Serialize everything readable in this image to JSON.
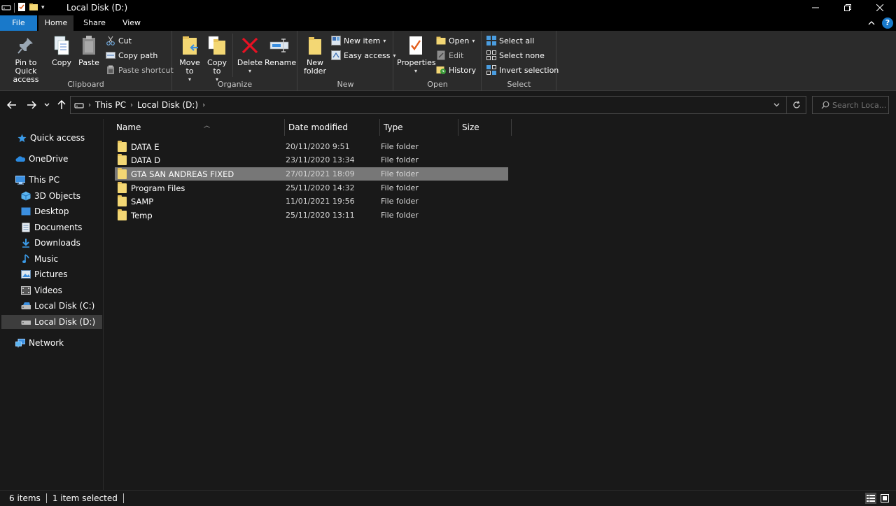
{
  "window": {
    "title": "Local Disk (D:)"
  },
  "tabs": {
    "file": "File",
    "home": "Home",
    "share": "Share",
    "view": "View"
  },
  "ribbon": {
    "clipboard": {
      "label": "Clipboard",
      "pin": "Pin to Quick access",
      "copy": "Copy",
      "paste": "Paste",
      "cut": "Cut",
      "copy_path": "Copy path",
      "paste_shortcut": "Paste shortcut"
    },
    "organize": {
      "label": "Organize",
      "move_to": "Move to",
      "copy_to": "Copy to",
      "delete": "Delete",
      "rename": "Rename"
    },
    "new": {
      "label": "New",
      "new_folder": "New folder",
      "new_item": "New item",
      "easy_access": "Easy access"
    },
    "open": {
      "label": "Open",
      "properties": "Properties",
      "open": "Open",
      "edit": "Edit",
      "history": "History"
    },
    "select": {
      "label": "Select",
      "select_all": "Select all",
      "select_none": "Select none",
      "invert_selection": "Invert selection"
    }
  },
  "address": {
    "crumbs": [
      "This PC",
      "Local Disk (D:)"
    ],
    "search_placeholder": "Search Loca..."
  },
  "sidebar": {
    "items": [
      {
        "label": "Quick access",
        "icon": "star-icon"
      },
      {
        "label": "OneDrive",
        "icon": "cloud-icon"
      },
      {
        "label": "This PC",
        "icon": "computer-icon"
      },
      {
        "label": "3D Objects",
        "icon": "cube-icon"
      },
      {
        "label": "Desktop",
        "icon": "desktop-icon"
      },
      {
        "label": "Documents",
        "icon": "documents-icon"
      },
      {
        "label": "Downloads",
        "icon": "download-icon"
      },
      {
        "label": "Music",
        "icon": "music-icon"
      },
      {
        "label": "Pictures",
        "icon": "pictures-icon"
      },
      {
        "label": "Videos",
        "icon": "videos-icon"
      },
      {
        "label": "Local Disk (C:)",
        "icon": "drive-icon"
      },
      {
        "label": "Local Disk (D:)",
        "icon": "drive-icon"
      },
      {
        "label": "Network",
        "icon": "network-icon"
      }
    ],
    "selected": "Local Disk (D:)"
  },
  "columns": {
    "name": "Name",
    "date": "Date modified",
    "type": "Type",
    "size": "Size"
  },
  "files": [
    {
      "name": "DATA  E",
      "date": "20/11/2020 9:51",
      "type": "File folder"
    },
    {
      "name": "DATA D",
      "date": "23/11/2020 13:34",
      "type": "File folder"
    },
    {
      "name": "GTA SAN ANDREAS FIXED",
      "date": "27/01/2021 18:09",
      "type": "File folder"
    },
    {
      "name": "Program Files",
      "date": "25/11/2020 14:32",
      "type": "File folder"
    },
    {
      "name": "SAMP",
      "date": "11/01/2021 19:56",
      "type": "File folder"
    },
    {
      "name": "Temp",
      "date": "25/11/2020 13:11",
      "type": "File folder"
    }
  ],
  "selected_file": "GTA SAN ANDREAS FIXED",
  "status": {
    "items": "6 items",
    "selected": "1 item selected"
  },
  "colors": {
    "accent": "#1979ca",
    "folder": "#f3d774",
    "selection": "#777777",
    "delete": "#e81123"
  }
}
